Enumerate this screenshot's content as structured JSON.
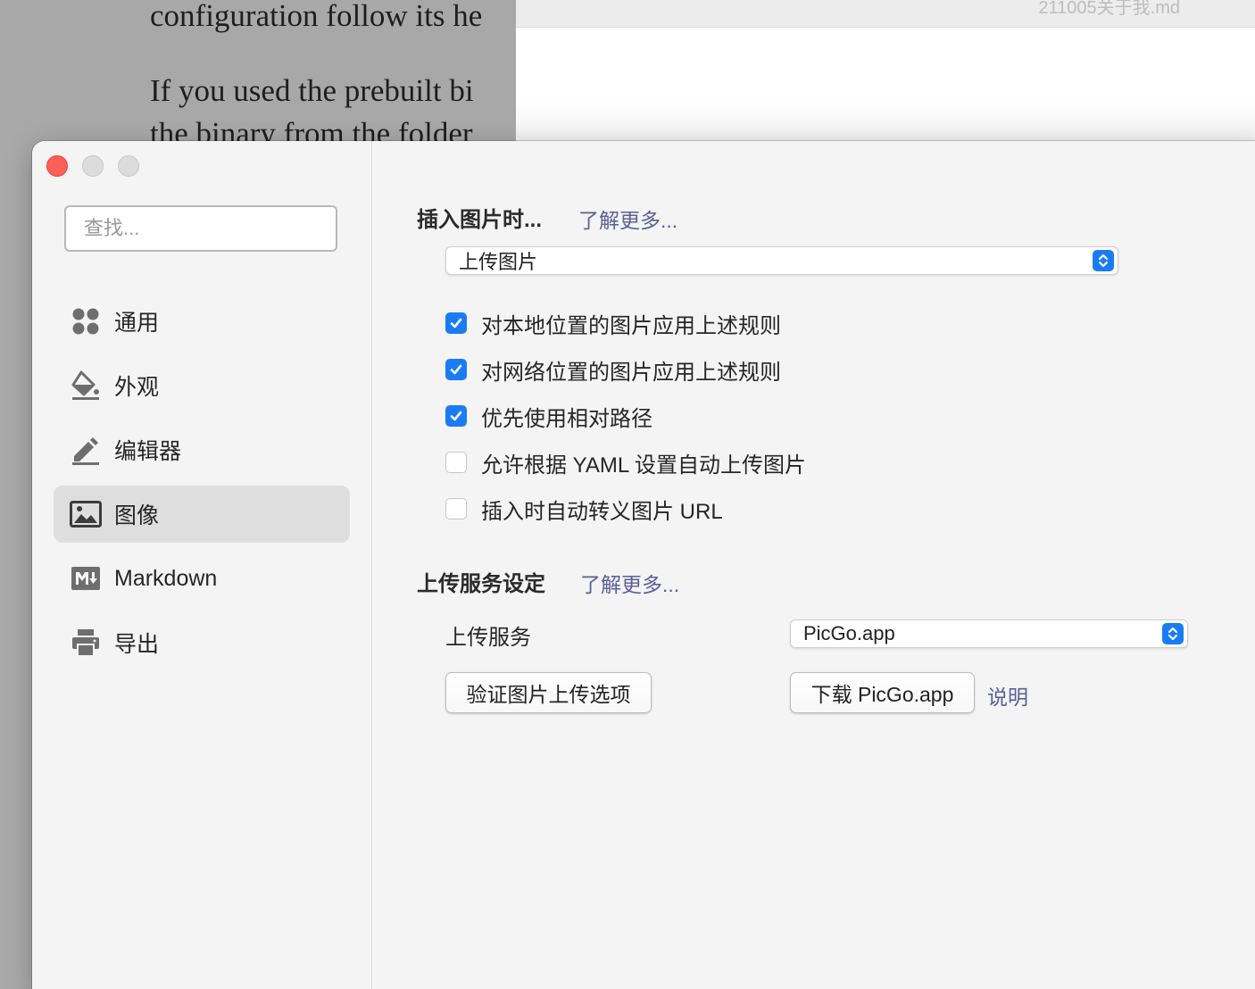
{
  "background": {
    "doc_lines": [
      "configuration follow its he",
      "If you used the prebuilt bi",
      "the binary from the folder"
    ],
    "window_title": "211005关于我.md"
  },
  "sidebar": {
    "search_placeholder": "查找...",
    "items": [
      {
        "label": "通用",
        "icon": "grid-icon"
      },
      {
        "label": "外观",
        "icon": "paint-bucket-icon"
      },
      {
        "label": "编辑器",
        "icon": "pencil-icon"
      },
      {
        "label": "图像",
        "icon": "image-icon",
        "active": true
      },
      {
        "label": "Markdown",
        "icon": "markdown-icon"
      },
      {
        "label": "导出",
        "icon": "printer-icon"
      }
    ]
  },
  "image_settings": {
    "insert_title": "插入图片时...",
    "learn_more": "了解更多...",
    "insert_action": "上传图片",
    "options": [
      {
        "label": "对本地位置的图片应用上述规则",
        "checked": true
      },
      {
        "label": "对网络位置的图片应用上述规则",
        "checked": true
      },
      {
        "label": "优先使用相对路径",
        "checked": true
      },
      {
        "label": "允许根据 YAML 设置自动上传图片",
        "checked": false
      },
      {
        "label": "插入时自动转义图片 URL",
        "checked": false
      }
    ]
  },
  "upload_settings": {
    "title": "上传服务设定",
    "learn_more": "了解更多...",
    "service_label": "上传服务",
    "service_value": "PicGo.app",
    "verify_button": "验证图片上传选项",
    "download_button": "下载 PicGo.app",
    "help_link": "说明"
  },
  "colors": {
    "accent": "#1a7cf5",
    "link": "#5b5f96",
    "close_button": "#fe5f57"
  }
}
